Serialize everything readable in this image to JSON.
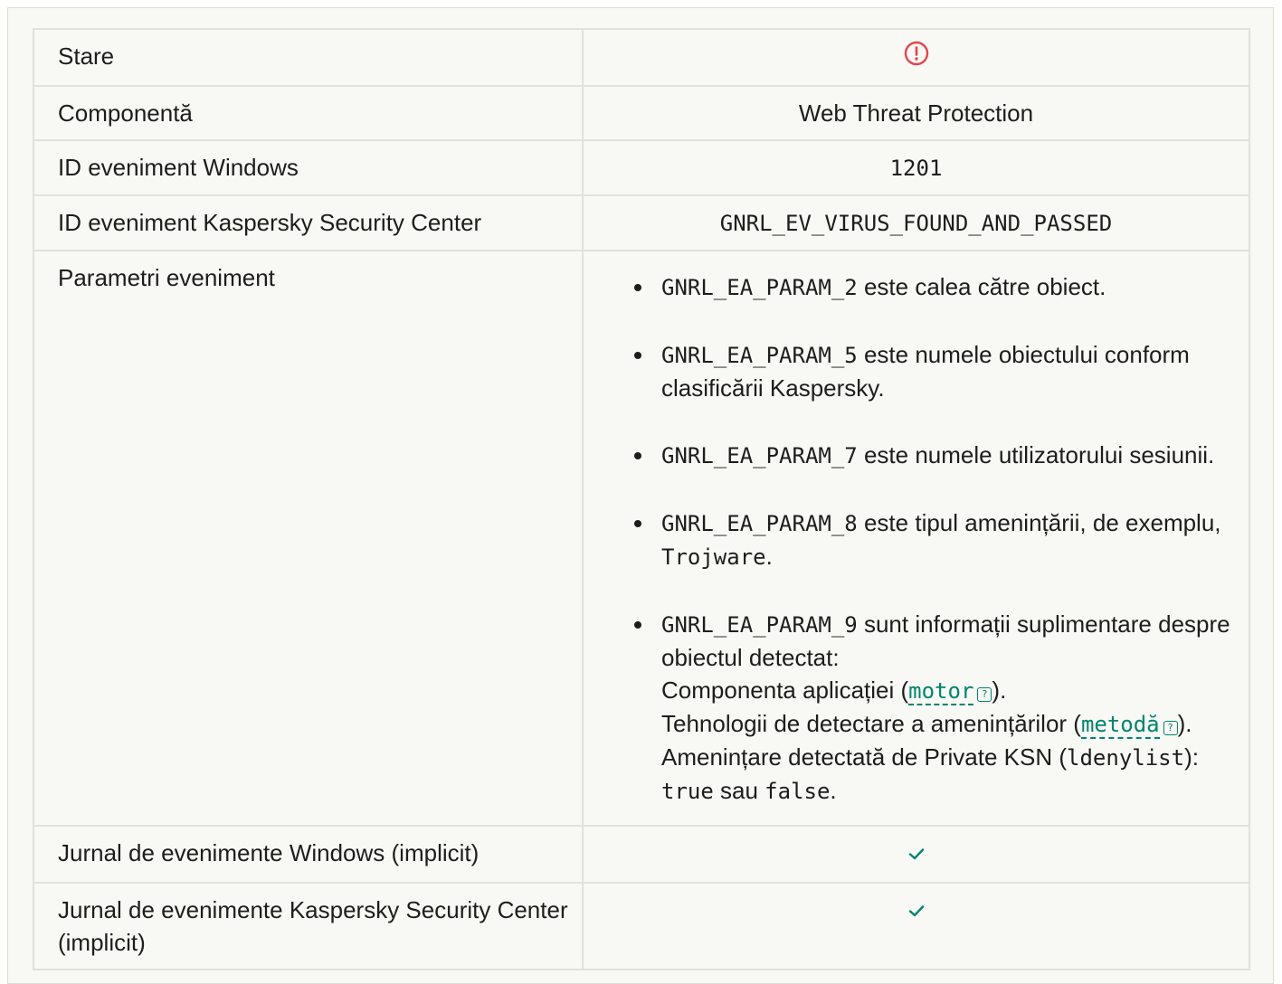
{
  "rows": {
    "stare": {
      "label": "Stare",
      "status_icon": "warning-circle-icon",
      "status_color": "#e0474c"
    },
    "componenta": {
      "label": "Componentă",
      "value": "Web Threat Protection"
    },
    "windows_id": {
      "label": "ID eveniment Windows",
      "value": "1201"
    },
    "ksc_id": {
      "label": "ID eveniment Kaspersky Security Center",
      "value": "GNRL_EV_VIRUS_FOUND_AND_PASSED"
    },
    "params": {
      "label": "Parametri eveniment",
      "items": [
        {
          "code": "GNRL_EA_PARAM_2",
          "text": " este calea către obiect."
        },
        {
          "code": "GNRL_EA_PARAM_5",
          "text": " este numele obiectului conform clasificării Kaspersky."
        },
        {
          "code": "GNRL_EA_PARAM_7",
          "text": " este numele utilizatorului sesiunii."
        },
        {
          "code": "GNRL_EA_PARAM_8",
          "text": " este tipul amenințării, de exemplu, ",
          "example": "Trojware",
          "suffix": "."
        },
        {
          "code": "GNRL_EA_PARAM_9",
          "text": " sunt informații suplimentare despre obiectul detectat:",
          "line1_pre": "Componenta aplicației (",
          "line1_link": "motor",
          "line1_post": ").",
          "line2_pre": "Tehnologii de detectare a amenințărilor (",
          "line2_link": "metodă",
          "line2_post": ").",
          "line3_pre": "Amenințare detectată de Private KSN (",
          "line3_code": "ldenylist",
          "line3_post": "):",
          "line4_true": "true",
          "line4_mid": " sau ",
          "line4_false": "false",
          "line4_post": "."
        }
      ]
    },
    "jurnal_windows": {
      "label": "Jurnal de evenimente Windows (implicit)",
      "icon": "checkmark-icon"
    },
    "jurnal_ksc": {
      "label": "Jurnal de evenimente Kaspersky Security Center (implicit)",
      "icon": "checkmark-icon"
    }
  },
  "colors": {
    "accent": "#00856f",
    "warning": "#e0474c"
  }
}
